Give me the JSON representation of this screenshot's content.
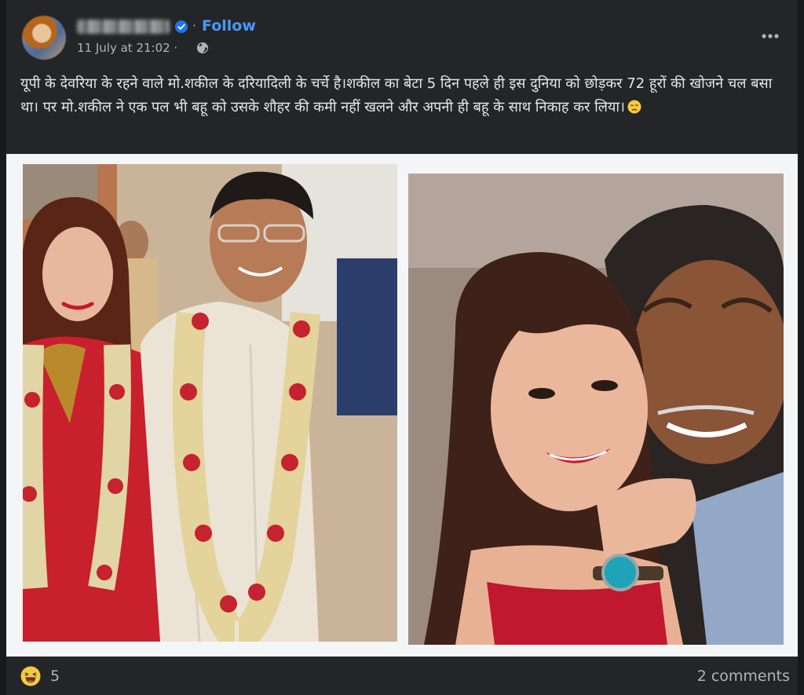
{
  "post": {
    "author_name": "Suraj Singh",
    "follow_label": "Follow",
    "separator": "·",
    "timestamp": "11 July at 21:02 ·",
    "privacy_icon": "globe-icon",
    "more_icon": "more-options-icon",
    "caption": "यूपी के देवरिया के रहने वाले मो.शकील के दरियादिली के चर्चे है।शकील का बेटा 5 दिन पहले ही इस दुनिया को छोड़कर 72 हूरों की खोजने चल बसा था। पर मो.शकील ने एक पल भी बहू को उसके शौहर की कमी नहीं खलने और अपनी ही बहू के साथ निकाह कर लिया।",
    "caption_emoji": "disappointed-face-emoji"
  },
  "reactions": {
    "icon": "haha-reaction-icon",
    "count": "5",
    "comments_label": "2 comments"
  },
  "colors": {
    "page_bg": "#18191a",
    "card_bg": "#242526",
    "text": "#e4e6eb",
    "muted": "#b0b3b8",
    "link": "#4599ff",
    "verified": "#1877f2"
  }
}
